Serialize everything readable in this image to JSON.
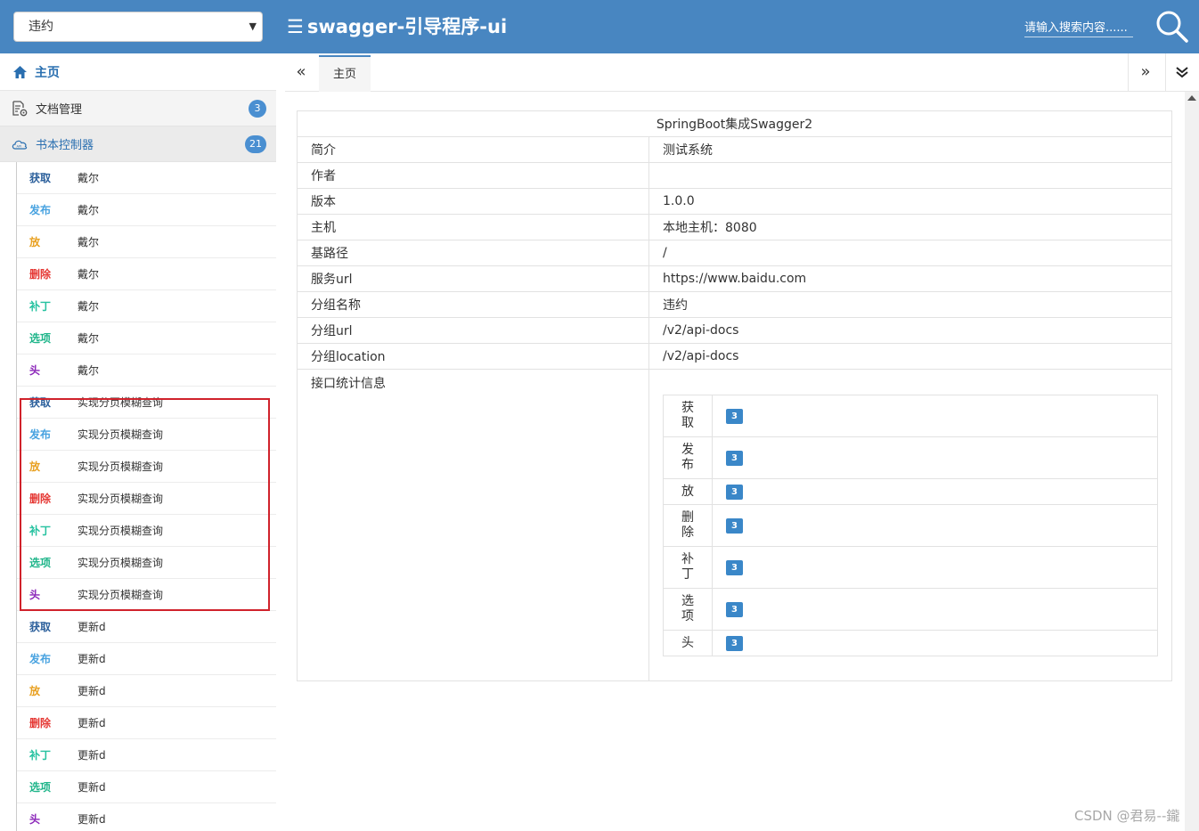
{
  "header": {
    "group_select": "违约",
    "menu_glyph": "☰",
    "title": "swagger-引导程序-ui",
    "search_placeholder": "请输入搜索内容......"
  },
  "sidebar": {
    "home": "主页",
    "sections": [
      {
        "label": "文档管理",
        "count": "3"
      },
      {
        "label": "书本控制器",
        "count": "21"
      }
    ],
    "methods": [
      {
        "label": "获取",
        "color": "#2b5f9b"
      },
      {
        "label": "发布",
        "color": "#49a3e0"
      },
      {
        "label": "放",
        "color": "#e8a020"
      },
      {
        "label": "删除",
        "color": "#e53935"
      },
      {
        "label": "补丁",
        "color": "#26c2a0"
      },
      {
        "label": "选项",
        "color": "#1fb58a"
      },
      {
        "label": "头",
        "color": "#8a24b8"
      }
    ],
    "groups": [
      {
        "name": "戴尔"
      },
      {
        "name": "实现分页模糊查询"
      },
      {
        "name": "更新d"
      }
    ]
  },
  "tabs": {
    "prev": "«",
    "home": "主页",
    "next": "»",
    "more": "⌄"
  },
  "info": {
    "title": "SpringBoot集成Swagger2",
    "rows": [
      {
        "k": "简介",
        "v": "测试系统"
      },
      {
        "k": "作者",
        "v": ""
      },
      {
        "k": "版本",
        "v": "1.0.0"
      },
      {
        "k": "主机",
        "v": "本地主机：8080"
      },
      {
        "k": "基路径",
        "v": "/"
      },
      {
        "k": "服务url",
        "v": "https://www.baidu.com"
      },
      {
        "k": "分组名称",
        "v": "违约"
      },
      {
        "k": "分组url",
        "v": "/v2/api-docs"
      },
      {
        "k": "分组location",
        "v": "/v2/api-docs"
      }
    ],
    "stats_label": "接口统计信息",
    "stats": [
      {
        "line1": "获",
        "line2": "取",
        "count": "3"
      },
      {
        "line1": "发",
        "line2": "布",
        "count": "3"
      },
      {
        "line1": "放",
        "line2": "",
        "count": "3"
      },
      {
        "line1": "删",
        "line2": "除",
        "count": "3"
      },
      {
        "line1": "补",
        "line2": "丁",
        "count": "3"
      },
      {
        "line1": "选",
        "line2": "项",
        "count": "3"
      },
      {
        "line1": "头",
        "line2": "",
        "count": "3"
      }
    ]
  },
  "watermark": "CSDN @君易--鑨"
}
